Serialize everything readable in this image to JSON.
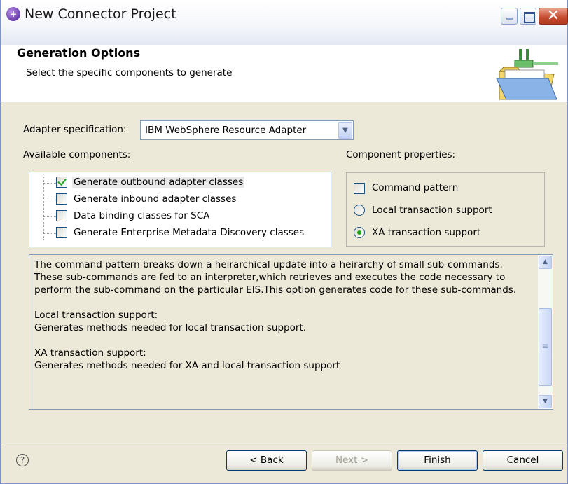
{
  "window": {
    "title": "New Connector Project"
  },
  "header": {
    "title": "Generation Options",
    "description": "Select the specific components to generate"
  },
  "form": {
    "adapter_label": "Adapter specification:",
    "adapter_value": "IBM WebSphere Resource Adapter",
    "available_label": "Available components:",
    "properties_label": "Component properties:"
  },
  "components": [
    {
      "label": "Generate outbound adapter classes",
      "checked": true
    },
    {
      "label": "Generate inbound adapter classes",
      "checked": false
    },
    {
      "label": "Data binding classes for SCA",
      "checked": false
    },
    {
      "label": "Generate Enterprise Metadata Discovery classes",
      "checked": false
    }
  ],
  "properties": {
    "command_pattern": {
      "label": "Command pattern",
      "checked": false
    },
    "local_tx": {
      "label": "Local transaction support",
      "selected": false
    },
    "xa_tx": {
      "label": "XA transaction support",
      "selected": true
    }
  },
  "description_text": "The command pattern breaks down a heirarchical update into a heirarchy of small sub-commands.  These sub-commands are fed to an interpreter,which retrieves and executes the code necessary to perform the sub-command on the particular EIS.This option generates code for these sub-commands.\n\nLocal transaction support:\nGenerates methods needed for local transaction support.\n\nXA transaction support:\nGenerates methods needed for XA and local transaction support",
  "buttons": {
    "back_prefix": "< ",
    "back_mnemonic": "B",
    "back_rest": "ack",
    "next": "Next >",
    "finish_mnemonic": "F",
    "finish_rest": "inish",
    "cancel": "Cancel"
  },
  "help_glyph": "?",
  "icons": {
    "window": "eclipse-connector-icon",
    "banner": "folder-connector-icon"
  }
}
